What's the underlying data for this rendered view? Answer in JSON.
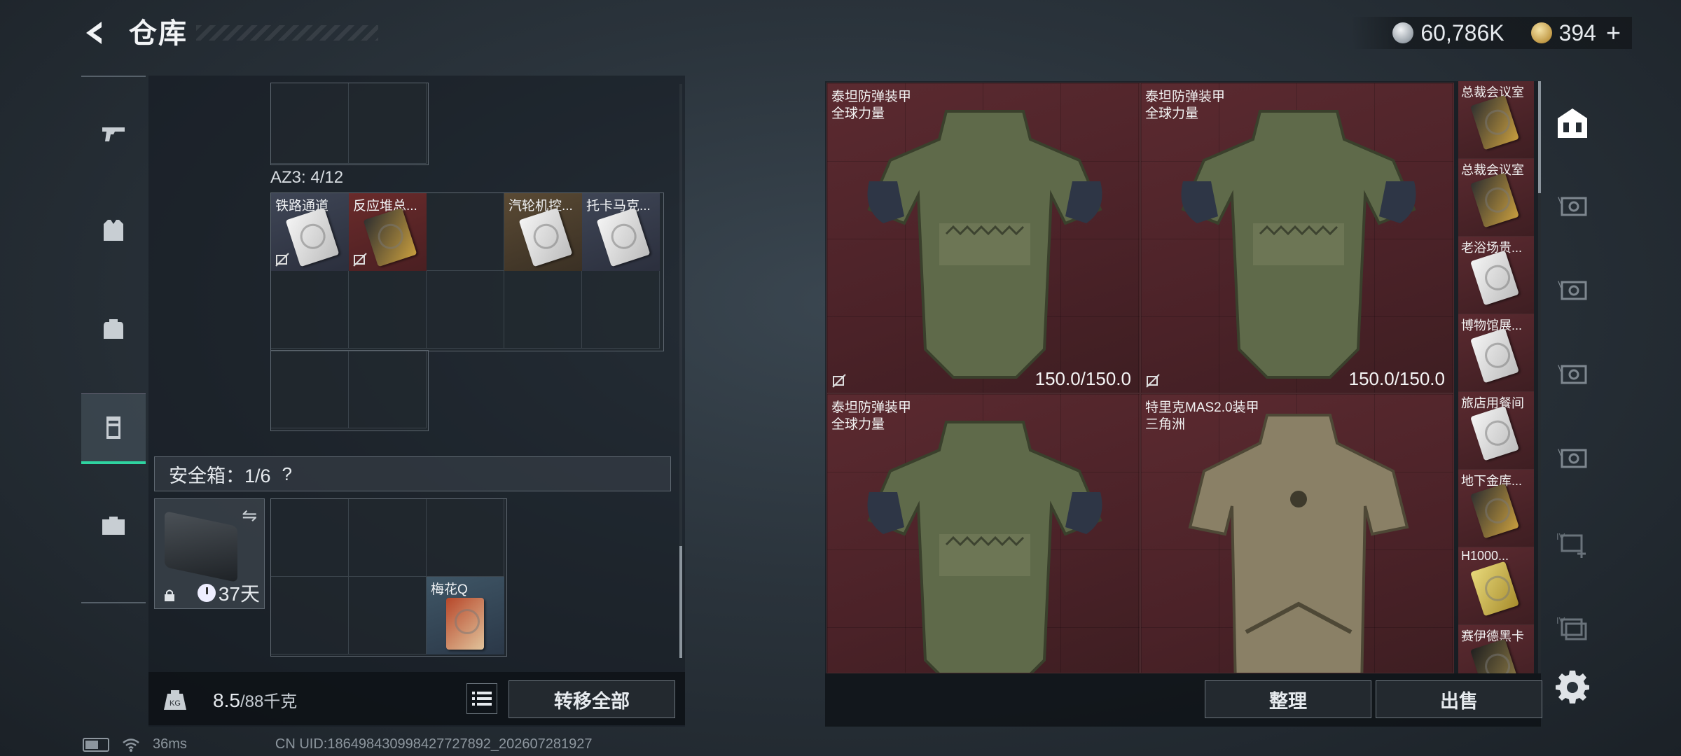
{
  "header": {
    "title": "仓库",
    "silver": "60,786K",
    "gold": "394",
    "plus": "+"
  },
  "left_nav": [
    "weapons",
    "armor",
    "backpack",
    "storage",
    "briefcase"
  ],
  "stash": {
    "az3_label": "AZ3: 4/12",
    "az3_items": [
      "铁路通道",
      "反应堆总...",
      "汽轮机控...",
      "托卡马克..."
    ],
    "safe_label": "安全箱：1/6",
    "safe_help": "?",
    "safe_days": "37天",
    "safe_item": "梅花Q",
    "weight_value": "8.5",
    "weight_max": "/88千克",
    "transfer_all": "转移全部"
  },
  "right": {
    "armors": [
      {
        "name": "泰坦防弹装甲",
        "sub": "全球力量",
        "durability": "150.0/150.0"
      },
      {
        "name": "泰坦防弹装甲",
        "sub": "全球力量",
        "durability": "150.0/150.0"
      },
      {
        "name": "泰坦防弹装甲",
        "sub": "全球力量",
        "durability": ""
      },
      {
        "name": "特里克MAS2.0装甲",
        "sub": "三角洲",
        "durability": ""
      }
    ],
    "keycards": [
      "总裁会议室",
      "总裁会议室",
      "老浴场贵...",
      "博物馆展...",
      "旅店用餐间",
      "地下金库...",
      "H1000...",
      "赛伊德黑卡"
    ],
    "sort_button": "整理",
    "sell_button": "出售"
  },
  "status": {
    "ping": "36ms",
    "uid": "CN UID:1864984309984277278​92_202607281927"
  }
}
